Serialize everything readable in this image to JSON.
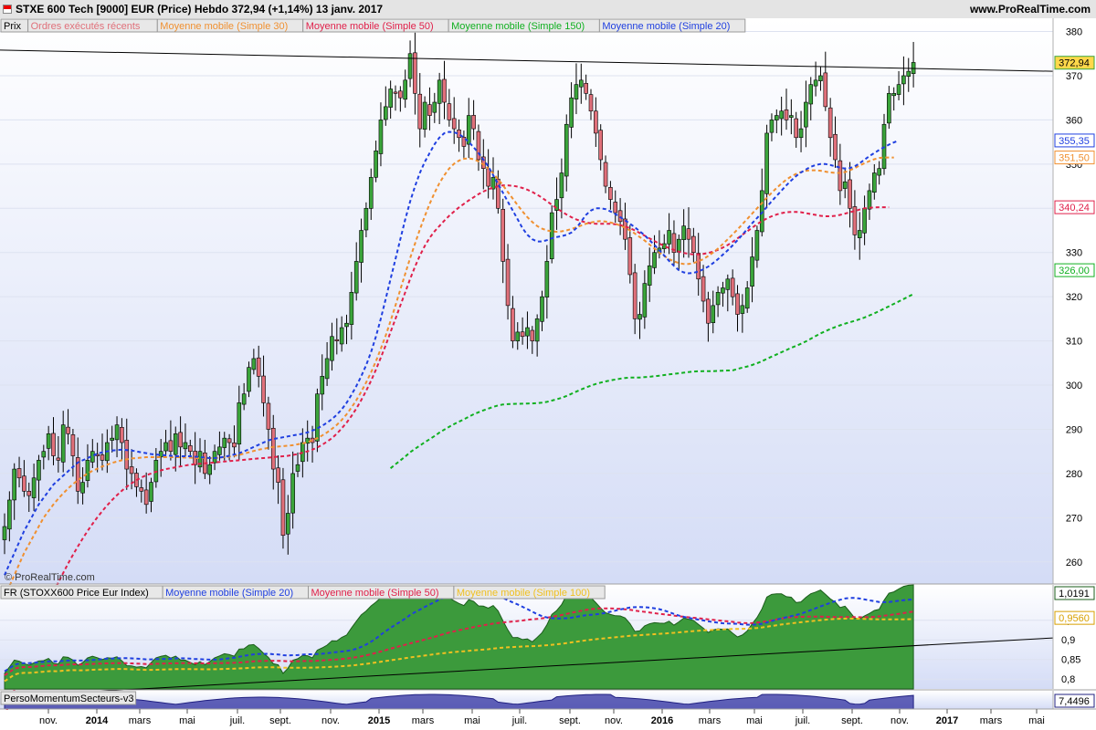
{
  "header": {
    "title": "STXE 600 Tech [9000] EUR (Price)   Hebdo   372,94 (+1,14%)   13 janv. 2017",
    "site": "www.ProRealTime.com"
  },
  "colors": {
    "price_up": "#3aa43a",
    "price_down": "#e0707a",
    "sma20": "#1f3fe0",
    "sma30": "#f09030",
    "sma50": "#e0204a",
    "sma150": "#10b020",
    "rs_area": "#3c9a3c",
    "rs_sma100": "#f0c020",
    "momentum": "#3030a0"
  },
  "watermark": "© ProRealTime.com",
  "chart_data": [
    {
      "type": "candlestick",
      "panel": "price",
      "legend": [
        "Prix",
        "Ordres exécutés récents",
        "Moyenne mobile (Simple 30)",
        "Moyenne mobile (Simple 50)",
        "Moyenne mobile (Simple 150)",
        "Moyenne mobile (Simple 20)"
      ],
      "ylim": [
        255,
        383
      ],
      "y_ticks": [
        260,
        270,
        280,
        290,
        300,
        310,
        320,
        330,
        340,
        350,
        360,
        370,
        380
      ],
      "x_labels": [
        "nov.",
        "2014",
        "mars",
        "mai",
        "juil.",
        "sept.",
        "nov.",
        "2015",
        "mars",
        "mai",
        "juil.",
        "sept.",
        "nov.",
        "2016",
        "mars",
        "mai",
        "juil.",
        "sept.",
        "nov.",
        "2017",
        "mars",
        "mai"
      ],
      "last_values": [
        {
          "label": "372,94",
          "series": "Prix",
          "value": 372.94
        },
        {
          "label": "355,35",
          "series": "Moyenne mobile (Simple 20)",
          "value": 355.35
        },
        {
          "label": "351,50",
          "series": "Moyenne mobile (Simple 30)",
          "value": 351.5
        },
        {
          "label": "340,24",
          "series": "Moyenne mobile (Simple 50)",
          "value": 340.24
        },
        {
          "label": "326,00",
          "series": "Moyenne mobile (Simple 150)",
          "value": 326.0
        }
      ],
      "trendline": {
        "from": [
          0,
          375.8
        ],
        "to": [
          200,
          371.0
        ]
      },
      "closes": [
        268,
        274,
        281,
        279,
        276,
        275,
        279,
        283,
        285,
        289,
        284,
        283,
        291,
        289,
        284,
        276,
        278,
        283,
        285,
        284,
        283,
        287,
        288,
        291,
        287,
        281,
        280,
        277,
        276,
        273,
        278,
        283,
        285,
        287,
        285,
        289,
        286,
        287,
        285,
        282,
        285,
        280,
        282,
        285,
        286,
        288,
        287,
        286,
        296,
        298,
        304,
        306,
        302,
        296,
        290,
        281,
        278,
        266,
        271,
        280,
        282,
        287,
        288,
        287,
        298,
        302,
        306,
        311,
        310,
        313,
        314,
        321,
        328,
        335,
        340,
        347,
        353,
        360,
        363,
        367,
        366,
        365,
        369,
        375,
        366,
        358,
        364,
        361,
        364,
        369,
        364,
        360,
        358,
        356,
        354,
        361,
        358,
        351,
        349,
        345,
        347,
        340,
        328,
        318,
        310,
        312,
        311,
        313,
        310,
        315,
        320,
        328,
        339,
        342,
        348,
        359,
        365,
        368,
        369,
        366,
        362,
        357,
        351,
        345,
        342,
        339,
        337,
        333,
        325,
        315,
        316,
        323,
        327,
        330,
        331,
        332,
        335,
        330,
        333,
        336,
        333,
        330,
        324,
        319,
        314,
        318,
        321,
        322,
        324,
        320,
        316,
        318,
        322,
        329,
        335,
        344,
        357,
        360,
        361,
        362,
        360,
        361,
        356,
        358,
        364,
        368,
        369,
        370,
        363,
        356,
        351,
        344,
        346,
        340,
        334,
        335,
        340,
        344,
        348,
        349,
        359,
        366,
        366,
        368,
        370,
        371,
        373
      ],
      "sma20": [
        257,
        259.5,
        262,
        264.5,
        267,
        269,
        271,
        273,
        274.5,
        276,
        277.5,
        278.5,
        279.5,
        280.5,
        281.5,
        282.5,
        283,
        283.5,
        284,
        284.5,
        284.8,
        285,
        285.2,
        285.3,
        285.4,
        285.3,
        285.2,
        285,
        284.8,
        284.6,
        284.4,
        284.3,
        284.2,
        284.1,
        284,
        283.9,
        283.9,
        283.9,
        283.9,
        283.8,
        283.7,
        283.6,
        283.5,
        283.5,
        283.6,
        283.8,
        284,
        284.3,
        284.6,
        285,
        285.5,
        286,
        286.5,
        287,
        287.5,
        287.8,
        288,
        288.2,
        288.4,
        288.6,
        288.8,
        289,
        289.3,
        289.7,
        290.2,
        290.8,
        291.5,
        292.3,
        293.3,
        294.5,
        296,
        297.8,
        299.8,
        302,
        304.5,
        307.5,
        311,
        315,
        319.5,
        324,
        328.5,
        333,
        337.5,
        341.5,
        345,
        348,
        350.5,
        352.5,
        354.5,
        356,
        357,
        357.3,
        357.2,
        356.8,
        356,
        355,
        353.8,
        352.5,
        351,
        349.5,
        347.5,
        345.5,
        343.5,
        341.5,
        339.5,
        337.5,
        335.5,
        334,
        333,
        332.5,
        332.5,
        332.8,
        333.2,
        333.5,
        333.7,
        334,
        334.5,
        335.5,
        337,
        338.5,
        339.5,
        340,
        340,
        339.8,
        339.3,
        338.7,
        338,
        337.3,
        336.5,
        335.7,
        334.8,
        333.9,
        332.8,
        331.7,
        330.5,
        329.3,
        328.1,
        327,
        326,
        325.5,
        325.3,
        325.4,
        325.7,
        326.2,
        326.8,
        327.6,
        328.5,
        329.5,
        330.5,
        331.6,
        332.8,
        334,
        335.3,
        336.6,
        337.8,
        339,
        340.3,
        341.6,
        342.8,
        344,
        345.2,
        346.3,
        347.3,
        348.1,
        348.8,
        349.4,
        349.8,
        350,
        350,
        349.8,
        349.5,
        349.2,
        349,
        349.1,
        349.5,
        350.2,
        351,
        351.8,
        352.5,
        353.2,
        353.8,
        354.4,
        354.9,
        355.35
      ],
      "sma30": [
        252,
        254.5,
        257,
        259.5,
        262,
        264,
        266,
        268,
        270,
        271.5,
        273,
        274.3,
        275.5,
        276.6,
        277.6,
        278.5,
        279.3,
        280,
        280.6,
        281.1,
        281.6,
        282,
        282.4,
        282.7,
        283,
        283.2,
        283.4,
        283.5,
        283.6,
        283.7,
        283.7,
        283.7,
        283.7,
        283.7,
        283.7,
        283.7,
        283.7,
        283.6,
        283.6,
        283.5,
        283.5,
        283.5,
        283.5,
        283.5,
        283.6,
        283.7,
        283.8,
        284,
        284.2,
        284.5,
        284.8,
        285.1,
        285.4,
        285.6,
        285.8,
        286,
        286.1,
        286.2,
        286.3,
        286.4,
        286.6,
        286.8,
        287.1,
        287.5,
        288,
        288.6,
        289.3,
        290.1,
        291,
        292.1,
        293.4,
        294.9,
        296.6,
        298.5,
        300.6,
        302.9,
        305.4,
        308.2,
        311.2,
        314.5,
        318,
        321.6,
        325.2,
        328.7,
        332,
        335.2,
        338.2,
        341,
        343.5,
        345.7,
        347.5,
        349,
        350.1,
        350.8,
        351.2,
        351.3,
        351.1,
        350.6,
        349.9,
        349,
        347.9,
        346.6,
        345.2,
        343.7,
        342.2,
        340.7,
        339.3,
        338,
        336.9,
        336,
        335.4,
        335,
        334.8,
        334.7,
        334.8,
        335,
        335.3,
        335.7,
        336.1,
        336.5,
        336.8,
        337,
        337.1,
        337,
        336.8,
        336.5,
        336.1,
        335.6,
        335,
        334.3,
        333.5,
        332.7,
        331.8,
        330.9,
        330,
        329.2,
        328.5,
        328,
        327.6,
        327.4,
        327.4,
        327.6,
        328,
        328.5,
        329.2,
        330,
        330.9,
        331.9,
        333,
        334.1,
        335.2,
        336.4,
        337.6,
        338.8,
        340,
        341.2,
        342.4,
        343.5,
        344.6,
        345.6,
        346.5,
        347.2,
        347.8,
        348.2,
        348.5,
        348.6,
        348.6,
        348.5,
        348.3,
        348.1,
        348,
        348,
        348.2,
        348.6,
        349.1,
        349.7,
        350.2,
        350.7,
        351.1,
        351.4,
        351.5,
        351.5,
        351.5
      ],
      "sma50": [
        225,
        228,
        231,
        234,
        237,
        240,
        243,
        245.5,
        248,
        250.5,
        253,
        255.3,
        257.5,
        259.6,
        261.6,
        263.5,
        265.3,
        267,
        268.6,
        270.1,
        271.5,
        272.8,
        274,
        275.1,
        276.1,
        277,
        277.8,
        278.5,
        279.1,
        279.6,
        280,
        280.4,
        280.7,
        281,
        281.2,
        281.4,
        281.6,
        281.8,
        282,
        282.1,
        282.2,
        282.3,
        282.4,
        282.5,
        282.6,
        282.7,
        282.8,
        282.9,
        283,
        283.1,
        283.2,
        283.3,
        283.4,
        283.5,
        283.6,
        283.7,
        283.8,
        283.9,
        284,
        284.2,
        284.4,
        284.7,
        285,
        285.4,
        285.9,
        286.5,
        287.2,
        288,
        289,
        290.2,
        291.5,
        293,
        294.7,
        296.6,
        298.7,
        301,
        303.5,
        306.2,
        309,
        312,
        315,
        318,
        321,
        324,
        326.8,
        329.3,
        331.5,
        333.3,
        334.8,
        336,
        337.2,
        338.3,
        339.3,
        340.2,
        341,
        341.8,
        342.5,
        343.2,
        343.8,
        344.3,
        344.7,
        345,
        345.2,
        345.2,
        345.1,
        344.9,
        344.6,
        344.2,
        343.7,
        343.1,
        342.4,
        341.6,
        340.8,
        340,
        339.3,
        338.6,
        338,
        337.5,
        337.1,
        336.8,
        336.6,
        336.5,
        336.5,
        336.5,
        336.5,
        336.4,
        336.2,
        335.9,
        335.5,
        335,
        334.4,
        333.8,
        333.2,
        332.6,
        332,
        331.5,
        331,
        330.6,
        330.2,
        329.9,
        329.7,
        329.6,
        329.6,
        329.7,
        329.9,
        330.2,
        330.6,
        331.1,
        331.7,
        332.4,
        333.2,
        334,
        334.8,
        335.6,
        336.4,
        337.1,
        337.7,
        338.2,
        338.6,
        338.9,
        339.1,
        339.2,
        339.2,
        339.1,
        338.9,
        338.7,
        338.5,
        338.3,
        338.2,
        338.2,
        338.3,
        338.5,
        338.8,
        339.1,
        339.4,
        339.7,
        340,
        340.1,
        340.2,
        340.24,
        340.24,
        340.24
      ],
      "sma150": [
        null,
        null,
        null,
        null,
        null,
        null,
        null,
        null,
        null,
        null,
        null,
        null,
        null,
        null,
        null,
        null,
        null,
        null,
        null,
        null,
        null,
        null,
        null,
        null,
        null,
        null,
        null,
        null,
        null,
        null,
        null,
        null,
        null,
        null,
        null,
        null,
        null,
        null,
        null,
        null,
        null,
        null,
        null,
        null,
        null,
        null,
        null,
        null,
        null,
        null,
        null,
        null,
        null,
        null,
        null,
        null,
        null,
        null,
        null,
        null,
        null,
        null,
        null,
        null,
        null,
        null,
        null,
        null,
        null,
        null,
        null,
        null,
        null,
        null,
        null,
        null,
        null,
        null,
        null,
        null,
        null,
        null,
        null,
        null,
        null,
        null,
        null,
        null,
        null,
        null,
        null,
        null,
        null,
        null,
        null,
        null,
        null,
        null,
        null,
        null,
        null,
        null,
        null,
        null,
        null,
        null,
        null,
        null,
        null,
        null,
        null,
        null,
        null,
        null,
        null,
        null,
        null,
        null,
        null,
        null,
        null,
        null,
        null,
        null,
        null,
        null,
        null,
        null,
        null,
        null,
        null,
        null,
        null,
        null,
        null,
        null,
        null,
        null,
        null,
        null,
        null,
        null,
        null,
        null,
        null,
        null,
        null,
        null,
        null,
        null,
        null,
        null,
        null,
        null,
        null,
        null,
        null,
        null,
        null,
        null,
        null,
        null,
        null,
        null,
        null,
        null,
        null,
        null,
        null,
        null,
        null,
        null,
        null,
        null,
        null,
        null,
        null,
        null,
        null,
        null,
        null,
        null,
        null,
        null,
        null,
        null,
        null,
        null,
        null,
        null,
        null,
        null,
        null,
        null,
        null,
        null,
        null
      ]
    },
    {
      "type": "area",
      "panel": "relative-strength",
      "legend": [
        "FR (STOXX600 Price Eur Index)",
        "Moyenne mobile (Simple 20)",
        "Moyenne mobile (Simple 50)",
        "Moyenne mobile (Simple 100)"
      ],
      "ylim": [
        0.775,
        1.04
      ],
      "y_ticks": [
        0.8,
        0.85,
        0.9,
        0.95
      ],
      "last_values": [
        {
          "label": "1,0191",
          "series": "FR (STOXX600 Price Eur Index)",
          "value": 1.0191
        },
        {
          "label": "0,9560",
          "series": "Moyenne mobile (Simple 100)",
          "value": 0.956
        }
      ],
      "trendline": {
        "from": [
          0,
          0.755
        ],
        "to": [
          240,
          0.905
        ]
      }
    },
    {
      "type": "area",
      "panel": "momentum",
      "legend": [
        "PersoMomentumSecteurs-v3"
      ],
      "last_values": [
        {
          "label": "7,4496",
          "series": "PersoMomentumSecteurs-v3",
          "value": 7.4496
        }
      ]
    }
  ]
}
